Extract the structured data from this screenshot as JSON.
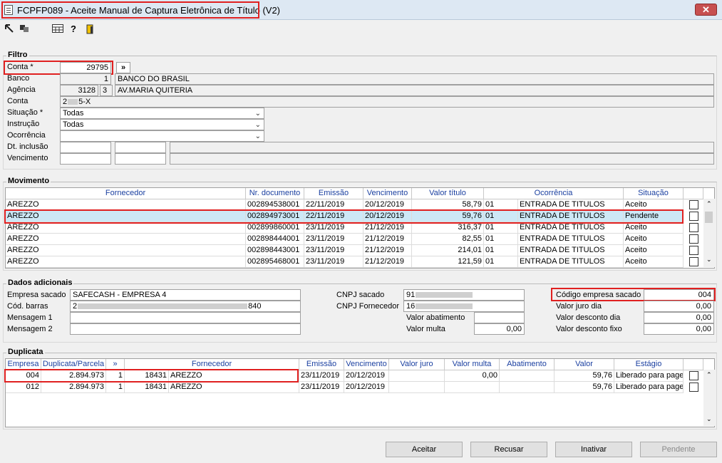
{
  "window": {
    "title": "FCPFP089 - Aceite Manual de Captura Eletrônica de Título (V2)",
    "close_glyph": "✕"
  },
  "toolbar": {
    "icons": [
      "arrow-icon",
      "copy-icon",
      "calendar-icon",
      "help-icon",
      "exit-icon"
    ]
  },
  "filtro": {
    "title": "Filtro",
    "conta_label": "Conta *",
    "conta_value": "29795",
    "expand": "»",
    "banco_label": "Banco",
    "banco_code": "1",
    "banco_name": "BANCO DO BRASIL",
    "agencia_label": "Agência",
    "agencia_code": "3128",
    "agencia_dv": "3",
    "agencia_name": "AV.MARIA QUITERIA",
    "conta2_label": "Conta",
    "conta2_prefix": "2",
    "conta2_suffix": "5-X",
    "situacao_label": "Situação *",
    "situacao_value": "Todas",
    "instrucao_label": "Instrução",
    "instrucao_value": "Todas",
    "ocorrencia_label": "Ocorrência",
    "ocorrencia_value": "",
    "dt_inclusao_label": "Dt. inclusão",
    "vencimento_label": "Vencimento"
  },
  "movimento": {
    "title": "Movimento",
    "headers": [
      "Fornecedor",
      "Nr. documento",
      "Emissão",
      "Vencimento",
      "Valor título",
      "Ocorrência",
      "Situação"
    ],
    "rows": [
      {
        "fornecedor": "AREZZO",
        "doc": "002894538001",
        "emissao": "22/11/2019",
        "venc": "20/12/2019",
        "valor": "58,79",
        "oc_code": "01",
        "oc": "ENTRADA DE TITULOS",
        "situacao": "Aceito"
      },
      {
        "fornecedor": "AREZZO",
        "doc": "002894973001",
        "emissao": "22/11/2019",
        "venc": "20/12/2019",
        "valor": "59,76",
        "oc_code": "01",
        "oc": "ENTRADA DE TITULOS",
        "situacao": "Pendente"
      },
      {
        "fornecedor": "AREZZO",
        "doc": "002899860001",
        "emissao": "23/11/2019",
        "venc": "21/12/2019",
        "valor": "316,37",
        "oc_code": "01",
        "oc": "ENTRADA DE TITULOS",
        "situacao": "Aceito"
      },
      {
        "fornecedor": "AREZZO",
        "doc": "002898444001",
        "emissao": "23/11/2019",
        "venc": "21/12/2019",
        "valor": "82,55",
        "oc_code": "01",
        "oc": "ENTRADA DE TITULOS",
        "situacao": "Aceito"
      },
      {
        "fornecedor": "AREZZO",
        "doc": "002898443001",
        "emissao": "23/11/2019",
        "venc": "21/12/2019",
        "valor": "214,01",
        "oc_code": "01",
        "oc": "ENTRADA DE TITULOS",
        "situacao": "Aceito"
      },
      {
        "fornecedor": "AREZZO",
        "doc": "002895468001",
        "emissao": "23/11/2019",
        "venc": "21/12/2019",
        "valor": "121,59",
        "oc_code": "01",
        "oc": "ENTRADA DE TITULOS",
        "situacao": "Aceito"
      }
    ]
  },
  "dados": {
    "title": "Dados adicionais",
    "empresa_sacado_label": "Empresa sacado",
    "empresa_sacado_value": "SAFECASH -  EMPRESA 4",
    "cod_barras_label": "Cód. barras",
    "cod_barras_prefix": "2",
    "cod_barras_suffix": "840",
    "mensagem1_label": "Mensagem 1",
    "mensagem2_label": "Mensagem 2",
    "cnpj_sacado_label": "CNPJ sacado",
    "cnpj_sacado_prefix": "91",
    "cnpj_fornecedor_label": "CNPJ Fornecedor",
    "cnpj_fornecedor_prefix": "16",
    "valor_abatimento_label": "Valor abatimento",
    "valor_multa_label": "Valor multa",
    "valor_multa_value": "0,00",
    "codigo_empresa_label": "Código empresa sacado",
    "codigo_empresa_value": "004",
    "valor_juro_label": "Valor juro dia",
    "valor_juro_value": "0,00",
    "valor_desconto_dia_label": "Valor desconto dia",
    "valor_desconto_dia_value": "0,00",
    "valor_desconto_fixo_label": "Valor desconto fixo",
    "valor_desconto_fixo_value": "0,00"
  },
  "duplicata": {
    "title": "Duplicata",
    "headers": [
      "Empresa",
      "Duplicata/Parcela",
      "»",
      "Fornecedor",
      "Emissão",
      "Vencimento",
      "Valor juro",
      "Valor multa",
      "Abatimento",
      "Valor",
      "Estágio"
    ],
    "rows": [
      {
        "empresa": "004",
        "duplicata": "2.894.973",
        "parcela": "1",
        "forn_code": "18431",
        "fornecedor": "AREZZO",
        "emissao": "23/11/2019",
        "venc": "20/12/2019",
        "juro": "",
        "multa": "0,00",
        "abat": "",
        "valor": "59,76",
        "estagio": "Liberado para page"
      },
      {
        "empresa": "012",
        "duplicata": "2.894.973",
        "parcela": "1",
        "forn_code": "18431",
        "fornecedor": "AREZZO",
        "emissao": "23/11/2019",
        "venc": "20/12/2019",
        "juro": "",
        "multa": "",
        "abat": "",
        "valor": "59,76",
        "estagio": "Liberado para page"
      }
    ]
  },
  "buttons": {
    "aceitar": "Aceitar",
    "recusar": "Recusar",
    "inativar": "Inativar",
    "pendente": "Pendente"
  }
}
